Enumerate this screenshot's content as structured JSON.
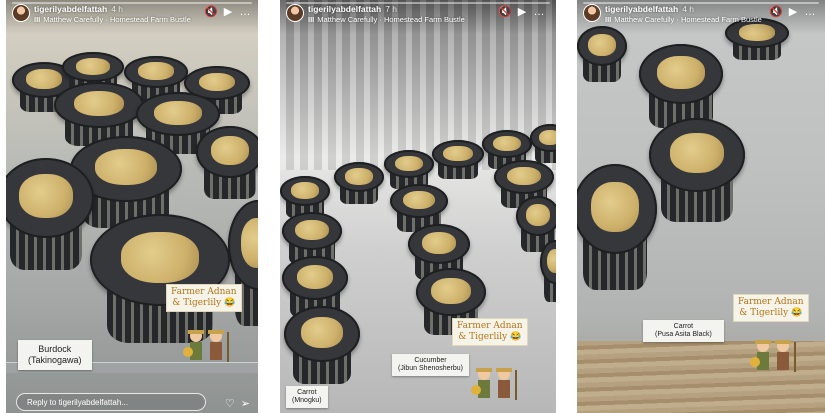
{
  "stories": [
    {
      "username": "tigerilyabdelfattah",
      "time": "4 h",
      "music": "Matthew Carefully · Homestead Farm Bustle",
      "music_bars": "III",
      "labels": [
        "Burdock\n(Takinogawa)"
      ],
      "sticker_text": "Farmer Adnan\n& Tigerlily 😂",
      "reply_placeholder": "Reply to tigerilyabdelfattah...",
      "reply_icons": [
        "♡",
        "➢"
      ]
    },
    {
      "username": "tigerilyabdelfattah",
      "time": "7 h",
      "music": "Matthew Carefully · Homestead Farm Bustle",
      "music_bars": "III",
      "labels": [
        "Carrot\n(Mnogku)",
        "Cucumber\n(Jibun Shenosherbu)"
      ],
      "sticker_text": "Farmer Adnan\n& Tigerlily 😂"
    },
    {
      "username": "tigerilyabdelfattah",
      "time": "4 h",
      "music": "Matthew Carefully · Homestead Farm Bustle",
      "music_bars": "III",
      "labels": [
        "Carrot\n(Pusa Asita Black)"
      ],
      "sticker_text": "Farmer Adnan\n& Tigerlily 😂"
    }
  ],
  "controls": {
    "mute_icon": "🔇",
    "play_icon": "▶",
    "more_icon": "…"
  },
  "colors": {
    "net_pot": "#2f3033",
    "rockwool": "#d9bf7d",
    "sticker_text": "#b4761a"
  }
}
